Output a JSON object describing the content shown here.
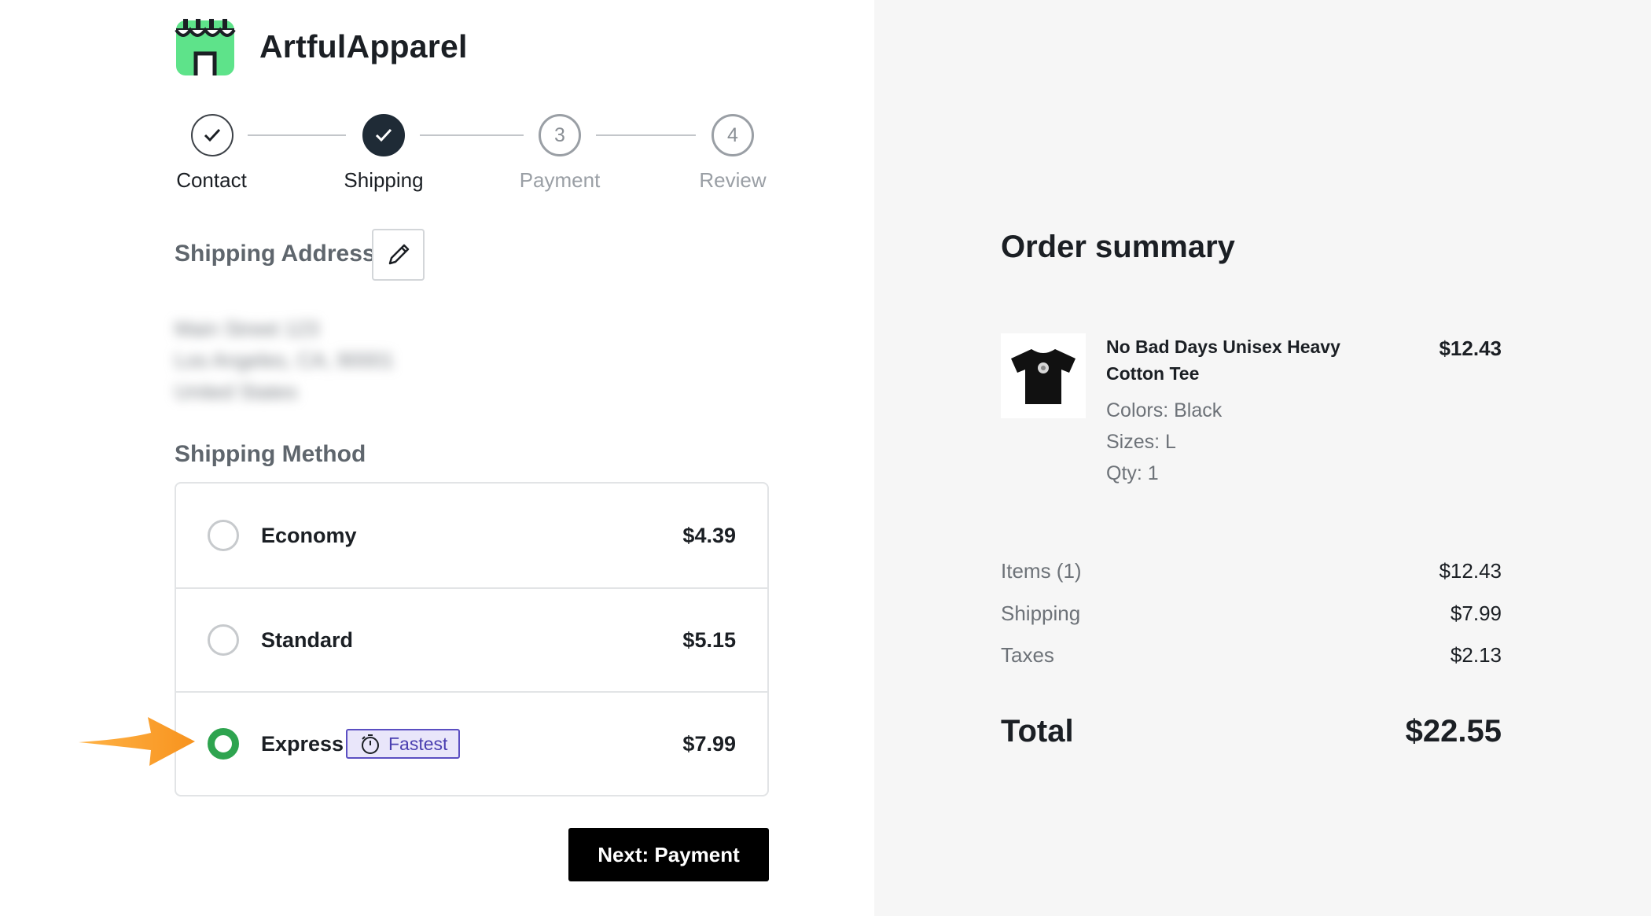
{
  "brand": {
    "name": "ArtfulApparel",
    "accent_color": "#2ea44f",
    "logo_color": "#5ee38a"
  },
  "stepper": {
    "steps": [
      {
        "label": "Contact",
        "number": "",
        "state": "completed"
      },
      {
        "label": "Shipping",
        "number": "",
        "state": "current"
      },
      {
        "label": "Payment",
        "number": "3",
        "state": "upcoming"
      },
      {
        "label": "Review",
        "number": "4",
        "state": "upcoming"
      }
    ]
  },
  "shipping_address": {
    "title": "Shipping Address",
    "edit_icon": "pencil-icon",
    "lines": [
      "Main Street 123",
      "Los Angeles, CA, 90001",
      "United States"
    ]
  },
  "shipping_method": {
    "title": "Shipping Method",
    "options": [
      {
        "name": "Economy",
        "price": "$4.39",
        "selected": false
      },
      {
        "name": "Standard",
        "price": "$5.15",
        "selected": false
      },
      {
        "name": "Express",
        "price": "$7.99",
        "selected": true,
        "badge": "Fastest",
        "badge_icon": "timer-icon"
      }
    ]
  },
  "next_button": "Next: Payment",
  "order_summary": {
    "title": "Order summary",
    "product": {
      "name": "No Bad Days Unisex Heavy Cotton Tee",
      "price": "$12.43",
      "colors": "Colors: Black",
      "sizes": "Sizes: L",
      "qty": "Qty: 1"
    },
    "rows": [
      {
        "label": "Items (1)",
        "value": "$12.43"
      },
      {
        "label": "Shipping",
        "value": "$7.99"
      },
      {
        "label": "Taxes",
        "value": "$2.13"
      }
    ],
    "total_label": "Total",
    "total_value": "$22.55"
  }
}
